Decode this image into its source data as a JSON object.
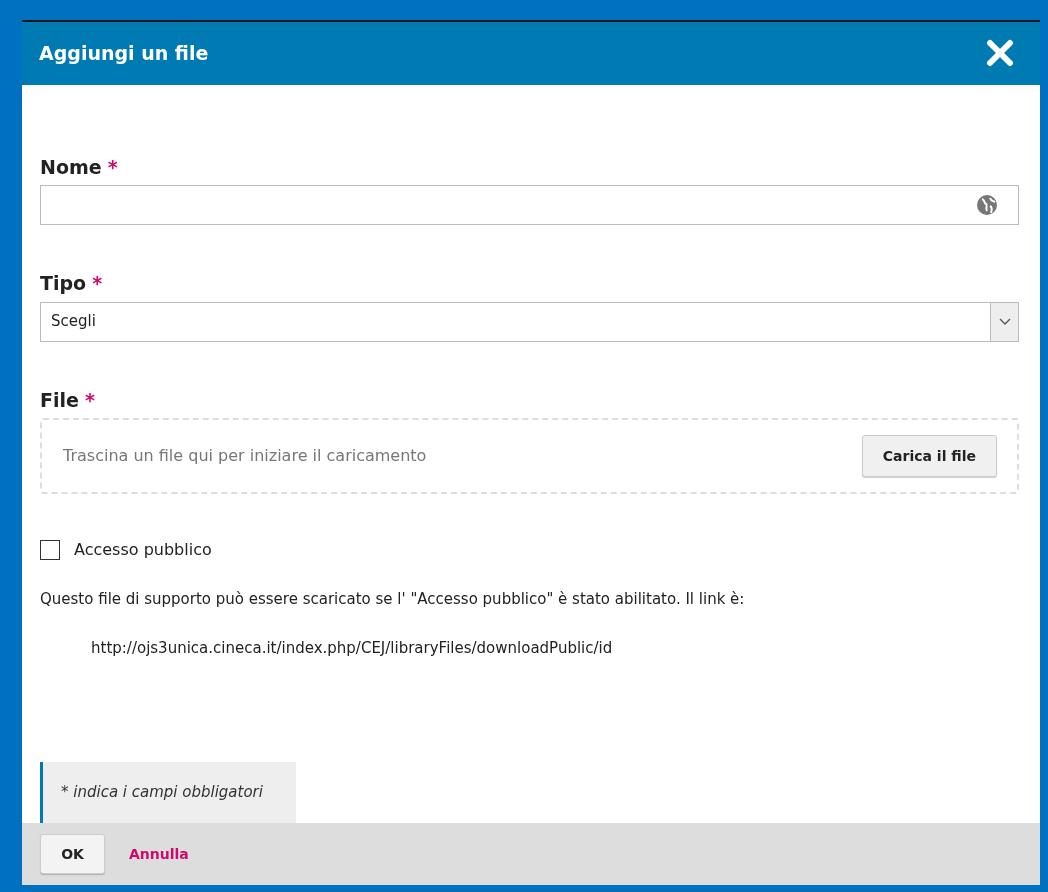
{
  "dialog": {
    "title": "Aggiungi un file"
  },
  "fields": [
    {
      "kind": "text",
      "label": "Nome",
      "required_mark": "*"
    },
    {
      "kind": "select",
      "label": "Tipo",
      "required_mark": "*",
      "value": "Scegli"
    },
    {
      "kind": "upload",
      "label": "File",
      "required_mark": "*",
      "hint": "Trascina un file qui per iniziare il caricamento",
      "button": "Carica il file"
    }
  ],
  "public_access": {
    "label": "Accesso pubblico",
    "checked": false
  },
  "description": "Questo file di supporto può essere scaricato se l' \"Accesso pubblico\" è stato abilitato. Il link è:",
  "link": "http://ojs3unica.cineca.it/index.php/CEJ/libraryFiles/downloadPublic/id",
  "required_note": "* indica i campi obbligatori",
  "buttons": {
    "ok": "OK",
    "cancel": "Annulla"
  }
}
